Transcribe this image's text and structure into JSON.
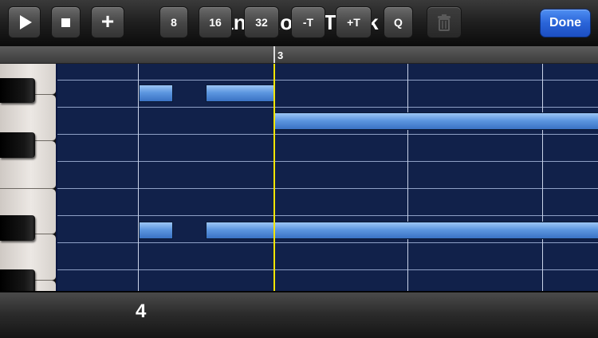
{
  "header": {
    "title": "Piano Roll - Track 2",
    "done_label": "Done"
  },
  "ruler": {
    "marker_label": "3"
  },
  "toolbar": {
    "play_icon": "play-icon",
    "stop_icon": "stop-icon",
    "add_icon": "plus-icon",
    "note_length": "4",
    "btn_8": "8",
    "btn_16": "16",
    "btn_32": "32",
    "btn_minus_t": "-T",
    "btn_plus_t": "+T",
    "btn_q": "Q",
    "trash_icon": "trash-icon"
  },
  "colors": {
    "grid_bg": "#11214a",
    "note": "#5d97e0",
    "playhead": "#f2e500",
    "done_button": "#2a64d8"
  }
}
